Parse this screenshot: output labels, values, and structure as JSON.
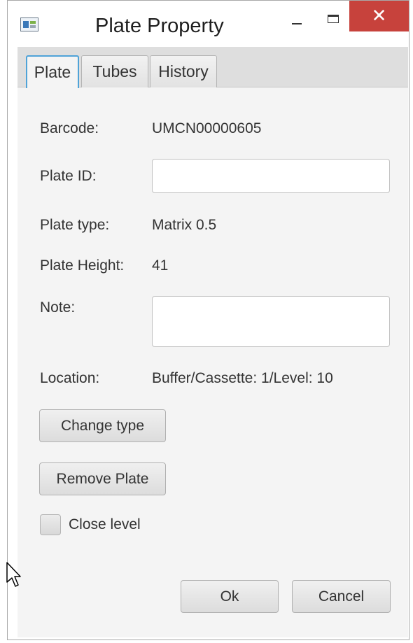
{
  "window": {
    "title": "Plate Property",
    "close_glyph": "✕",
    "app_icon": "app-window-icon"
  },
  "tabs": [
    {
      "label": "Plate",
      "active": true
    },
    {
      "label": "Tubes",
      "active": false
    },
    {
      "label": "History",
      "active": false
    }
  ],
  "form": {
    "barcode_label": "Barcode:",
    "barcode_value": "UMCN00000605",
    "plate_id_label": "Plate ID:",
    "plate_id_value": "",
    "plate_type_label": "Plate type:",
    "plate_type_value": "Matrix 0.5",
    "plate_height_label": "Plate Height:",
    "plate_height_value": "41",
    "note_label": "Note:",
    "note_value": "",
    "location_label": "Location:",
    "location_value": "Buffer/Cassette: 1/Level: 10"
  },
  "actions": {
    "change_type_label": "Change type",
    "remove_plate_label": "Remove Plate",
    "close_level_label": "Close level",
    "close_level_checked": false,
    "ok_label": "Ok",
    "cancel_label": "Cancel"
  },
  "colors": {
    "close_button": "#c7423c",
    "active_tab_border": "#4fa3d8",
    "dialog_background": "#f4f4f4"
  }
}
